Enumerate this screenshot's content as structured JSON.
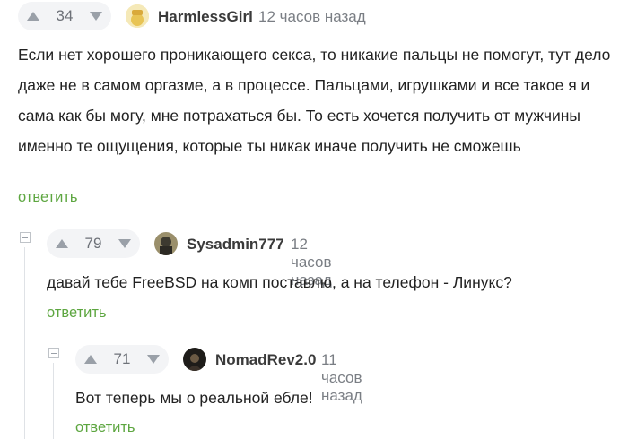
{
  "comments": [
    {
      "votes": "34",
      "username": "HarmlessGirl",
      "time": "12 часов назад",
      "text": "Если нет хорошего проникающего секса, то никакие пальцы не помогут, тут дело даже не в самом оргазме, а в процессе. Пальцами, игрушками и все такое я и сама как бы могу, мне потрахаться бы. То есть хочется получить от мужчины именно те ощущения, которые ты никак иначе получить не сможешь",
      "reply": "ответить"
    },
    {
      "votes": "79",
      "username": "Sysadmin777",
      "time": "12 часов назад",
      "text": "давай тебе FreeBSD на комп поставлю, а на телефон - Линукс?",
      "reply": "ответить"
    },
    {
      "votes": "71",
      "username": "NomadRev2.0",
      "time": "11 часов назад",
      "text": "Вот теперь мы о реальной ебле!",
      "reply": "ответить"
    }
  ],
  "colors": {
    "reply": "#5da640",
    "vote_bg": "#f3f4f6"
  },
  "icons": {
    "upvote": "triangle-up-icon",
    "downvote": "triangle-down-icon",
    "collapse": "minus-box-icon"
  }
}
